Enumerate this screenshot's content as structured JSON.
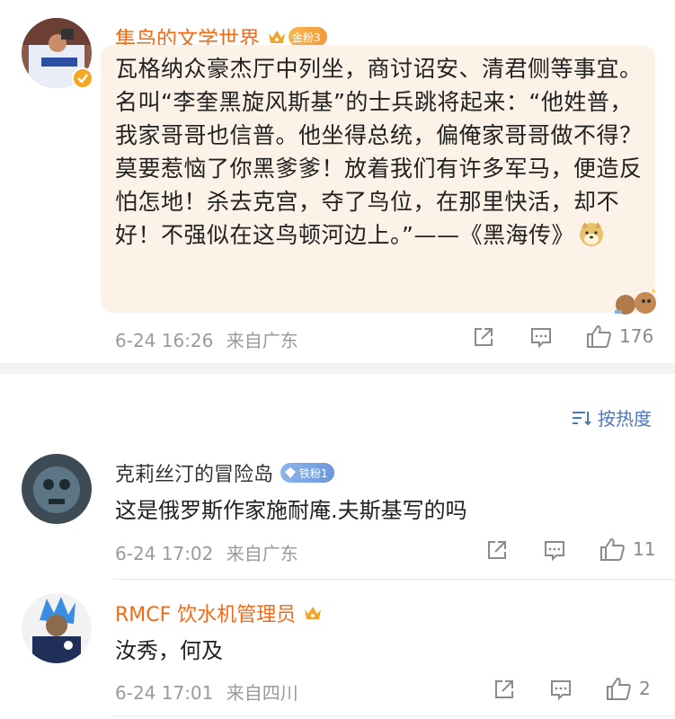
{
  "post": {
    "author": "隼鸟的文学世界",
    "badge": "金粉3",
    "text": "瓦格纳众豪杰厅中列坐，商讨诏安、清君侧等事宜。 名叫“李奎黑旋风斯基”的士兵跳将起来：“他姓普，我家哥哥也信普。他坐得总统，偏俺家哥哥做不得？莫要惹恼了你黑爹爹！放着我们有许多军马，便造反怕怎地！杀去克宫，夺了鸟位，在那里快活，却不好！不强似在这鸟顿河边上。”——《黑海传》",
    "time": "6-24 16:26",
    "source": "来自广东",
    "likes": "176"
  },
  "sort_label": "按热度",
  "comments": [
    {
      "author": "克莉丝汀的冒险岛",
      "badge": "铁粉1",
      "text": "这是俄罗斯作家施耐庵.夫斯基写的吗",
      "time": "6-24 17:02",
      "source": "来自广东",
      "likes": "11"
    },
    {
      "author": "RMCF 饮水机管理员",
      "text": "汝秀，何及",
      "time": "6-24 17:01",
      "source": "来自四川",
      "likes": "2"
    }
  ],
  "colors": {
    "name": "#f26a16",
    "link": "#4a77ba",
    "bubble": "#fdf2e8"
  }
}
